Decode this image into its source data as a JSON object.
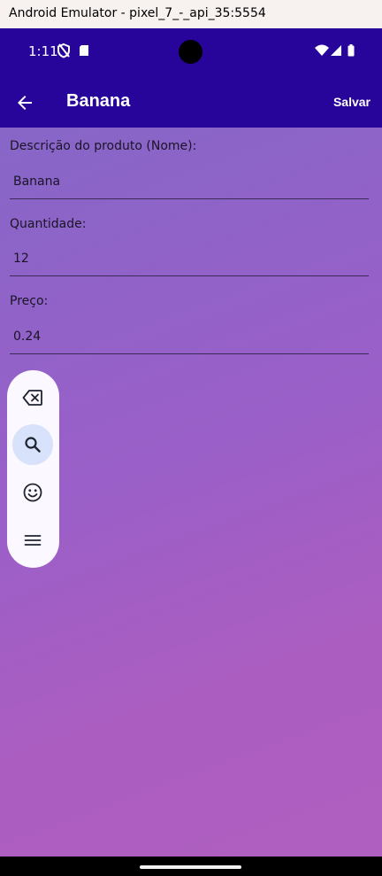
{
  "window": {
    "title": "Android Emulator - pixel_7_-_api_35:5554"
  },
  "status_bar": {
    "time": "1:11"
  },
  "app_bar": {
    "title": "Banana",
    "action_label": "Salvar"
  },
  "form": {
    "name": {
      "label": "Descrição do produto (Nome):",
      "value": "Banana"
    },
    "quantity": {
      "label": "Quantidade:",
      "value": "12"
    },
    "price": {
      "label": "Preço:",
      "value": "0.24"
    }
  },
  "keyboard_toolbar": {
    "items": [
      "backspace-icon",
      "search-icon",
      "emoji-icon",
      "menu-icon"
    ],
    "active": "search-icon"
  },
  "colors": {
    "app_bar": "#27049a",
    "background_start": "#8766c8",
    "background_end": "#ae5fc0",
    "toolbar": "#fbf8ff",
    "active_button": "#d8e2fb"
  }
}
